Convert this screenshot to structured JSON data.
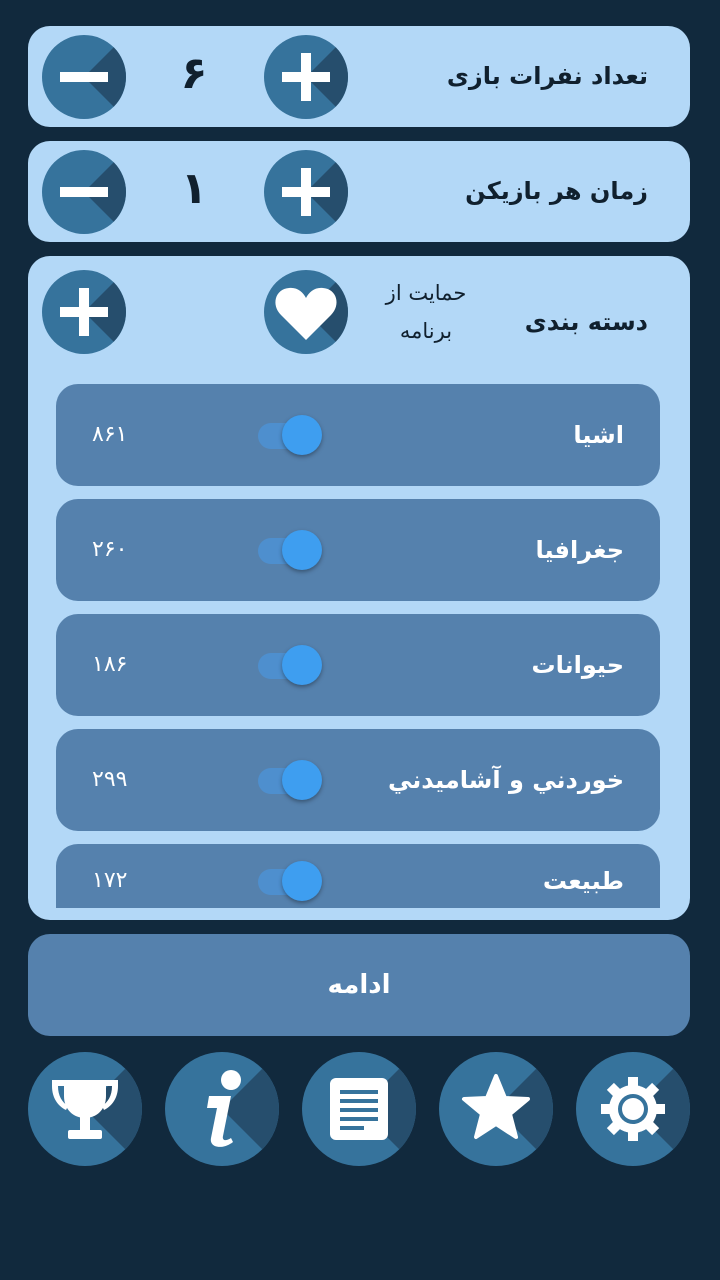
{
  "players": {
    "label": "تعداد نفرات بازی",
    "value": "۶"
  },
  "time": {
    "label": "زمان هر بازیکن",
    "value": "۱"
  },
  "categories": {
    "label": "دسته بندی",
    "support_line1": "حمایت از",
    "support_line2": "برنامه",
    "items": [
      {
        "name": "اشيا",
        "count": "۸۶۱",
        "enabled": true
      },
      {
        "name": "جغرافيا",
        "count": "۲۶۰",
        "enabled": true
      },
      {
        "name": "حيوانات",
        "count": "۱۸۶",
        "enabled": true
      },
      {
        "name": "خوردني و آشاميدني",
        "count": "۲۹۹",
        "enabled": true
      },
      {
        "name": "طبيعت",
        "count": "۱۷۲",
        "enabled": true
      }
    ]
  },
  "continue_label": "ادامه",
  "bottom_nav": [
    "trophy-icon",
    "info-icon",
    "document-icon",
    "star-icon",
    "gear-icon"
  ],
  "colors": {
    "background": "#11293d",
    "panel": "#b3d8f7",
    "row": "#5581ad",
    "button": "#36739c",
    "toggle": "#3e9ef0"
  }
}
